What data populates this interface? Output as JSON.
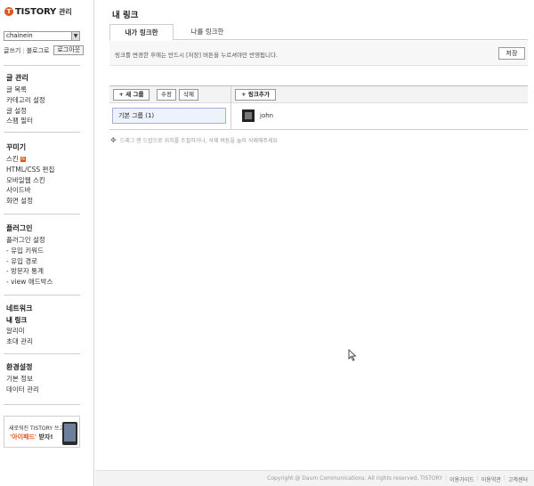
{
  "brand": {
    "logo_letter": "T",
    "name": "TISTORY",
    "sub": "관리"
  },
  "blog_select": {
    "value": "chainein"
  },
  "top_links": {
    "write": "글쓰기",
    "blog": "블로그로",
    "logout": "로그아웃"
  },
  "menu": [
    {
      "title": "글 관리",
      "items": [
        {
          "label": "글 목록"
        },
        {
          "label": "카테고리 설정"
        },
        {
          "label": "글 설정"
        },
        {
          "label": "스팸 필터"
        }
      ]
    },
    {
      "title": "꾸미기",
      "items": [
        {
          "label": "스킨",
          "badge": "N"
        },
        {
          "label": "HTML/CSS 편집"
        },
        {
          "label": "모바일웹 스킨"
        },
        {
          "label": "사이드바"
        },
        {
          "label": "화면 설정"
        }
      ]
    },
    {
      "title": "플러그인",
      "items": [
        {
          "label": "플러그인 설정"
        },
        {
          "label": "- 유입 키워드"
        },
        {
          "label": "- 유입 경로"
        },
        {
          "label": "- 방문자 통계"
        },
        {
          "label": "- view 애드박스"
        }
      ]
    },
    {
      "title": "네트워크",
      "items": [
        {
          "label": "내 링크",
          "active": true
        },
        {
          "label": "알리미"
        },
        {
          "label": "초대 관리"
        }
      ]
    },
    {
      "title": "환경설정",
      "items": [
        {
          "label": "기본 정보"
        },
        {
          "label": "데이터 관리"
        }
      ]
    }
  ],
  "banner": {
    "line1": "새로워진 TISTORY 쓰고",
    "line2_highlight": "'아이패드'",
    "line2_rest": " 받자!"
  },
  "main": {
    "title": "내 링크",
    "tabs": [
      {
        "label": "내가 링크한"
      },
      {
        "label": "나를 링크한"
      }
    ],
    "notice": "링크를 변경한 후에는 반드시 [저장] 버튼을 누르셔야만 반영됩니다.",
    "save": "저장",
    "buttons": {
      "new_group": "+ 새 그룹",
      "edit": "수정",
      "delete": "삭제",
      "add_link": "+ 링크추가"
    },
    "group": "기본 그룹 (1)",
    "link_name": "john",
    "hint": "드래그 앤 드랍으로 위치를 조절하거나, 삭제 버튼을 눌러 삭제해주세요"
  },
  "footer": {
    "copyright": "Copyright @ Daum Communications. All rights reserved, TISTORY",
    "links": [
      "이용가이드",
      "이용약관",
      "고객센터"
    ]
  },
  "colors": {
    "brand": "#e0541d",
    "selected_group_bg": "#eef2fb",
    "selected_group_border": "#9fb2d8"
  }
}
